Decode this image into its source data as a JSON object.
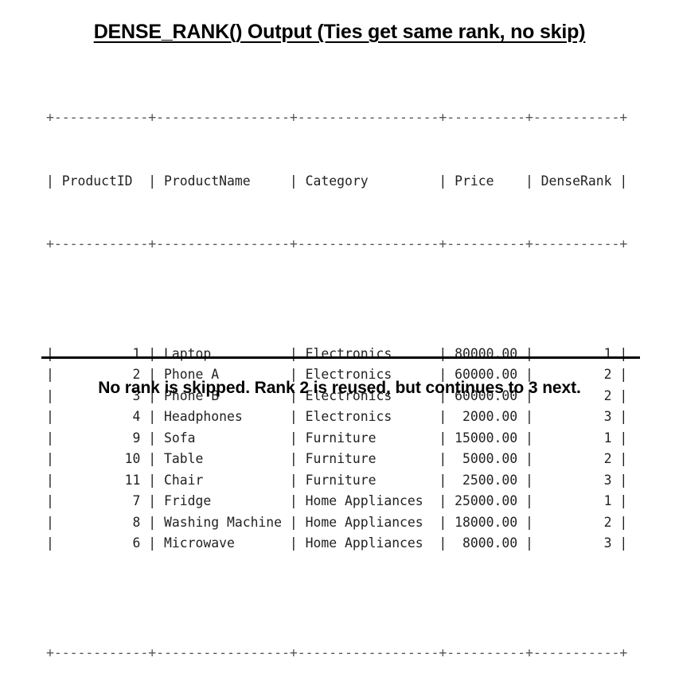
{
  "title": "DENSE_RANK() Output (Ties get same rank, no skip)",
  "table": {
    "border": "+------------+------------------+--------------------+-----------+------------+",
    "header": "| ProductID | ProductName      | Category          | Price     | DenseRank |",
    "columns": [
      "ProductID",
      "ProductName",
      "Category",
      "Price",
      "DenseRank"
    ],
    "rows": [
      {
        "id": "1",
        "name": "Laptop",
        "category": "Electronics",
        "price": "80000.00",
        "rank": "1"
      },
      {
        "id": "2",
        "name": "Phone A",
        "category": "Electronics",
        "price": "60000.00",
        "rank": "2"
      },
      {
        "id": "3",
        "name": "Phone B",
        "category": "Electronics",
        "price": "60000.00",
        "rank": "2"
      },
      {
        "id": "4",
        "name": "Headphones",
        "category": "Electronics",
        "price": "2000.00",
        "rank": "3"
      },
      {
        "id": "9",
        "name": "Sofa",
        "category": "Furniture",
        "price": "15000.00",
        "rank": "1"
      },
      {
        "id": "10",
        "name": "Table",
        "category": "Furniture",
        "price": "5000.00",
        "rank": "2"
      },
      {
        "id": "11",
        "name": "Chair",
        "category": "Furniture",
        "price": "2500.00",
        "rank": "3"
      },
      {
        "id": "7",
        "name": "Fridge",
        "category": "Home Appliances",
        "price": "25000.00",
        "rank": "1"
      },
      {
        "id": "8",
        "name": "Washing Machine",
        "category": "Home Appliances",
        "price": "18000.00",
        "rank": "2"
      },
      {
        "id": "6",
        "name": "Microwave",
        "category": "Home Appliances",
        "price": "8000.00",
        "rank": "3"
      }
    ]
  },
  "footnote": "No rank is skipped. Rank 2 is reused, but continues to 3 next."
}
